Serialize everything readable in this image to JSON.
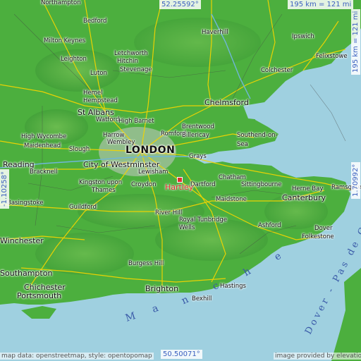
{
  "map": {
    "place": "Hartley",
    "coords": {
      "top": "52.25592°",
      "bottom": "50.50071°",
      "left": "-1.10258°",
      "right": "1.70992°"
    },
    "scale": {
      "top": "195 km = 121 mi",
      "right": "195 km = 121 mi"
    },
    "footer": {
      "left": "map data: openstreetmap, style: opentopomap",
      "right": "image provided by elevationmap"
    },
    "sea_labels": {
      "manche": [
        "M",
        "a",
        "n",
        "c",
        "h",
        "e"
      ],
      "dover": "Dover - Pas de Calais"
    },
    "cities": [
      {
        "name": "Northampton",
        "size": "small"
      },
      {
        "name": "Bedford",
        "size": "small"
      },
      {
        "name": "Milton Keynes",
        "size": "small"
      },
      {
        "name": "Haverhill",
        "size": "small"
      },
      {
        "name": "Ipswich",
        "size": "small"
      },
      {
        "name": "Leighton",
        "size": "small"
      },
      {
        "name": "Letchworth",
        "size": "small"
      },
      {
        "name": "Hitchin",
        "size": "small"
      },
      {
        "name": "Stevenage",
        "size": "small"
      },
      {
        "name": "Felixstowe",
        "size": "small"
      },
      {
        "name": "Luton",
        "size": "small"
      },
      {
        "name": "Colchester",
        "size": "small"
      },
      {
        "name": "Hemel",
        "size": "small"
      },
      {
        "name": "Hempstead",
        "size": "small"
      },
      {
        "name": "Chelmsford",
        "size": "mid"
      },
      {
        "name": "St Albans",
        "size": "mid"
      },
      {
        "name": "Watford",
        "size": "small"
      },
      {
        "name": "High Barnet",
        "size": "small"
      },
      {
        "name": "Brentwood",
        "size": "small"
      },
      {
        "name": "Romford",
        "size": "small"
      },
      {
        "name": "Billericay",
        "size": "small"
      },
      {
        "name": "Southend-on-",
        "size": "small"
      },
      {
        "name": "Sea",
        "size": "small"
      },
      {
        "name": "High Wycombe",
        "size": "small"
      },
      {
        "name": "Harrow",
        "size": "small"
      },
      {
        "name": "Wembley",
        "size": "small"
      },
      {
        "name": "Maidenhead",
        "size": "small"
      },
      {
        "name": "Slough",
        "size": "small"
      },
      {
        "name": "LONDON",
        "size": "big"
      },
      {
        "name": "Grays",
        "size": "small"
      },
      {
        "name": "Reading",
        "size": "mid"
      },
      {
        "name": "City of Westminster",
        "size": "mid"
      },
      {
        "name": "Bracknell",
        "size": "small"
      },
      {
        "name": "Lewisham",
        "size": "small"
      },
      {
        "name": "Chatham",
        "size": "small"
      },
      {
        "name": "Kingston upon",
        "size": "small"
      },
      {
        "name": "Croydon",
        "size": "small"
      },
      {
        "name": "Dartford",
        "size": "small"
      },
      {
        "name": "Sittingbourne",
        "size": "small"
      },
      {
        "name": "Thames",
        "size": "small"
      },
      {
        "name": "Herne Bay",
        "size": "small"
      },
      {
        "name": "Ramsgate",
        "size": "small"
      },
      {
        "name": "Basingstoke",
        "size": "small"
      },
      {
        "name": "Maidstone",
        "size": "small"
      },
      {
        "name": "Canterbury",
        "size": "mid"
      },
      {
        "name": "Guildford",
        "size": "small"
      },
      {
        "name": "River Hill",
        "size": "small"
      },
      {
        "name": "Royal Tunbridge",
        "size": "small"
      },
      {
        "name": "Wells",
        "size": "small"
      },
      {
        "name": "Ashford",
        "size": "small"
      },
      {
        "name": "Dover",
        "size": "small"
      },
      {
        "name": "Folkestone",
        "size": "small"
      },
      {
        "name": "Winchester",
        "size": "mid"
      },
      {
        "name": "Burgess Hill",
        "size": "small"
      },
      {
        "name": "Southampton",
        "size": "mid"
      },
      {
        "name": "Chichester",
        "size": "mid"
      },
      {
        "name": "Brighton",
        "size": "mid"
      },
      {
        "name": "Hastings",
        "size": "small"
      },
      {
        "name": "Portsmouth",
        "size": "mid"
      },
      {
        "name": "Bexhill",
        "size": "small"
      }
    ],
    "colors": {
      "land": "#4caf3e",
      "sea": "#9fd0e0",
      "roads": "#f2d400",
      "marker": "#e23030",
      "coord_text": "#3b5fbf"
    }
  }
}
